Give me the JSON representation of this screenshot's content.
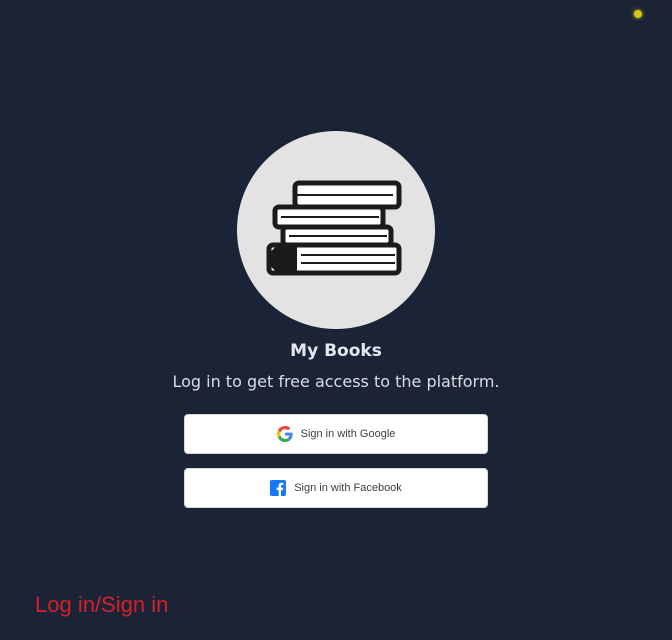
{
  "app": {
    "title": "My Books",
    "subtitle": "Log in to get free access to the platform.",
    "logo_icon": "books-stack-icon"
  },
  "auth": {
    "google_label": "Sign in with Google",
    "google_icon": "google-icon",
    "facebook_label": "Sign in with Facebook",
    "facebook_icon": "facebook-icon"
  },
  "caption": {
    "text": "Log in/Sign in"
  },
  "colors": {
    "background": "#1b2436",
    "logo_circle": "#e3e3e3",
    "caption": "#d4202a",
    "facebook_blue": "#1877f2",
    "status_dot": "#d8c51a"
  }
}
